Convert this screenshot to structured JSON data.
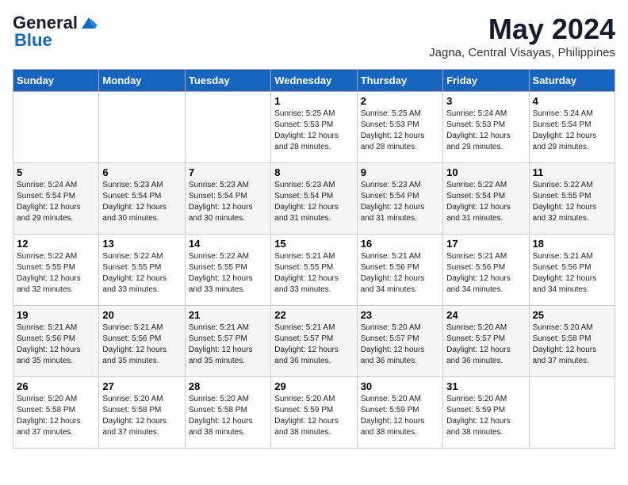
{
  "header": {
    "logo_general": "General",
    "logo_blue": "Blue",
    "title": "May 2024",
    "subtitle": "Jagna, Central Visayas, Philippines"
  },
  "days_of_week": [
    "Sunday",
    "Monday",
    "Tuesday",
    "Wednesday",
    "Thursday",
    "Friday",
    "Saturday"
  ],
  "weeks": [
    [
      {
        "day": "",
        "info": ""
      },
      {
        "day": "",
        "info": ""
      },
      {
        "day": "",
        "info": ""
      },
      {
        "day": "1",
        "info": "Sunrise: 5:25 AM\nSunset: 5:53 PM\nDaylight: 12 hours\nand 28 minutes."
      },
      {
        "day": "2",
        "info": "Sunrise: 5:25 AM\nSunset: 5:53 PM\nDaylight: 12 hours\nand 28 minutes."
      },
      {
        "day": "3",
        "info": "Sunrise: 5:24 AM\nSunset: 5:53 PM\nDaylight: 12 hours\nand 29 minutes."
      },
      {
        "day": "4",
        "info": "Sunrise: 5:24 AM\nSunset: 5:54 PM\nDaylight: 12 hours\nand 29 minutes."
      }
    ],
    [
      {
        "day": "5",
        "info": "Sunrise: 5:24 AM\nSunset: 5:54 PM\nDaylight: 12 hours\nand 29 minutes."
      },
      {
        "day": "6",
        "info": "Sunrise: 5:23 AM\nSunset: 5:54 PM\nDaylight: 12 hours\nand 30 minutes."
      },
      {
        "day": "7",
        "info": "Sunrise: 5:23 AM\nSunset: 5:54 PM\nDaylight: 12 hours\nand 30 minutes."
      },
      {
        "day": "8",
        "info": "Sunrise: 5:23 AM\nSunset: 5:54 PM\nDaylight: 12 hours\nand 31 minutes."
      },
      {
        "day": "9",
        "info": "Sunrise: 5:23 AM\nSunset: 5:54 PM\nDaylight: 12 hours\nand 31 minutes."
      },
      {
        "day": "10",
        "info": "Sunrise: 5:22 AM\nSunset: 5:54 PM\nDaylight: 12 hours\nand 31 minutes."
      },
      {
        "day": "11",
        "info": "Sunrise: 5:22 AM\nSunset: 5:55 PM\nDaylight: 12 hours\nand 32 minutes."
      }
    ],
    [
      {
        "day": "12",
        "info": "Sunrise: 5:22 AM\nSunset: 5:55 PM\nDaylight: 12 hours\nand 32 minutes."
      },
      {
        "day": "13",
        "info": "Sunrise: 5:22 AM\nSunset: 5:55 PM\nDaylight: 12 hours\nand 33 minutes."
      },
      {
        "day": "14",
        "info": "Sunrise: 5:22 AM\nSunset: 5:55 PM\nDaylight: 12 hours\nand 33 minutes."
      },
      {
        "day": "15",
        "info": "Sunrise: 5:21 AM\nSunset: 5:55 PM\nDaylight: 12 hours\nand 33 minutes."
      },
      {
        "day": "16",
        "info": "Sunrise: 5:21 AM\nSunset: 5:56 PM\nDaylight: 12 hours\nand 34 minutes."
      },
      {
        "day": "17",
        "info": "Sunrise: 5:21 AM\nSunset: 5:56 PM\nDaylight: 12 hours\nand 34 minutes."
      },
      {
        "day": "18",
        "info": "Sunrise: 5:21 AM\nSunset: 5:56 PM\nDaylight: 12 hours\nand 34 minutes."
      }
    ],
    [
      {
        "day": "19",
        "info": "Sunrise: 5:21 AM\nSunset: 5:56 PM\nDaylight: 12 hours\nand 35 minutes."
      },
      {
        "day": "20",
        "info": "Sunrise: 5:21 AM\nSunset: 5:56 PM\nDaylight: 12 hours\nand 35 minutes."
      },
      {
        "day": "21",
        "info": "Sunrise: 5:21 AM\nSunset: 5:57 PM\nDaylight: 12 hours\nand 35 minutes."
      },
      {
        "day": "22",
        "info": "Sunrise: 5:21 AM\nSunset: 5:57 PM\nDaylight: 12 hours\nand 36 minutes."
      },
      {
        "day": "23",
        "info": "Sunrise: 5:20 AM\nSunset: 5:57 PM\nDaylight: 12 hours\nand 36 minutes."
      },
      {
        "day": "24",
        "info": "Sunrise: 5:20 AM\nSunset: 5:57 PM\nDaylight: 12 hours\nand 36 minutes."
      },
      {
        "day": "25",
        "info": "Sunrise: 5:20 AM\nSunset: 5:58 PM\nDaylight: 12 hours\nand 37 minutes."
      }
    ],
    [
      {
        "day": "26",
        "info": "Sunrise: 5:20 AM\nSunset: 5:58 PM\nDaylight: 12 hours\nand 37 minutes."
      },
      {
        "day": "27",
        "info": "Sunrise: 5:20 AM\nSunset: 5:58 PM\nDaylight: 12 hours\nand 37 minutes."
      },
      {
        "day": "28",
        "info": "Sunrise: 5:20 AM\nSunset: 5:58 PM\nDaylight: 12 hours\nand 38 minutes."
      },
      {
        "day": "29",
        "info": "Sunrise: 5:20 AM\nSunset: 5:59 PM\nDaylight: 12 hours\nand 38 minutes."
      },
      {
        "day": "30",
        "info": "Sunrise: 5:20 AM\nSunset: 5:59 PM\nDaylight: 12 hours\nand 38 minutes."
      },
      {
        "day": "31",
        "info": "Sunrise: 5:20 AM\nSunset: 5:59 PM\nDaylight: 12 hours\nand 38 minutes."
      },
      {
        "day": "",
        "info": ""
      }
    ]
  ]
}
